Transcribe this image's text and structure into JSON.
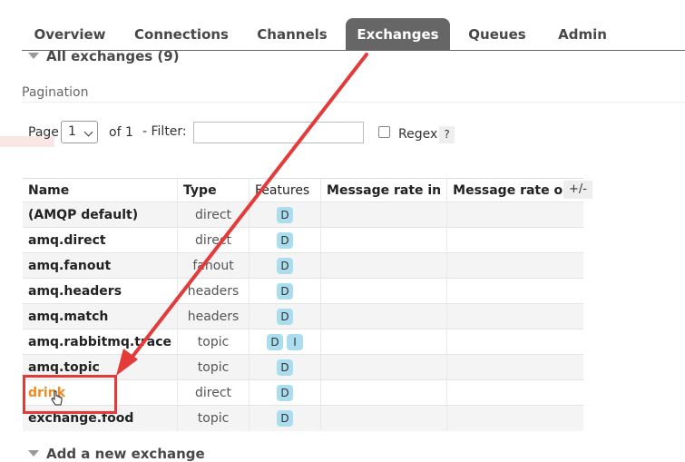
{
  "tabs": [
    "Overview",
    "Connections",
    "Channels",
    "Exchanges",
    "Queues",
    "Admin"
  ],
  "active_tab": "Exchanges",
  "section_title": "All exchanges (9)",
  "pagination": {
    "title": "Pagination",
    "page_label": "Page",
    "page_value": "1",
    "of_label": "of 1",
    "filter_label": "- Filter:",
    "filter_value": "",
    "regex_label": "Regex",
    "help_label": "?"
  },
  "table": {
    "columns": [
      "Name",
      "Type",
      "Features",
      "Message rate in",
      "Message rate out"
    ],
    "toggle_label": "+/-",
    "rows": [
      {
        "name": "(AMQP default)",
        "type": "direct",
        "features": [
          "D"
        ]
      },
      {
        "name": "amq.direct",
        "type": "direct",
        "features": [
          "D"
        ]
      },
      {
        "name": "amq.fanout",
        "type": "fanout",
        "features": [
          "D"
        ]
      },
      {
        "name": "amq.headers",
        "type": "headers",
        "features": [
          "D"
        ]
      },
      {
        "name": "amq.match",
        "type": "headers",
        "features": [
          "D"
        ]
      },
      {
        "name": "amq.rabbitmq.trace",
        "type": "topic",
        "features": [
          "D",
          "I"
        ]
      },
      {
        "name": "amq.topic",
        "type": "topic",
        "features": [
          "D"
        ]
      },
      {
        "name": "drink",
        "type": "direct",
        "features": [
          "D"
        ]
      },
      {
        "name": "exchange.food",
        "type": "topic",
        "features": [
          "D"
        ]
      }
    ]
  },
  "add_section_title": "Add a new exchange",
  "colors": {
    "active_tab_bg": "#666666",
    "highlight_link": "#f0891e",
    "annotation_red": "#e43a3a",
    "badge_bg": "#aaddee"
  }
}
